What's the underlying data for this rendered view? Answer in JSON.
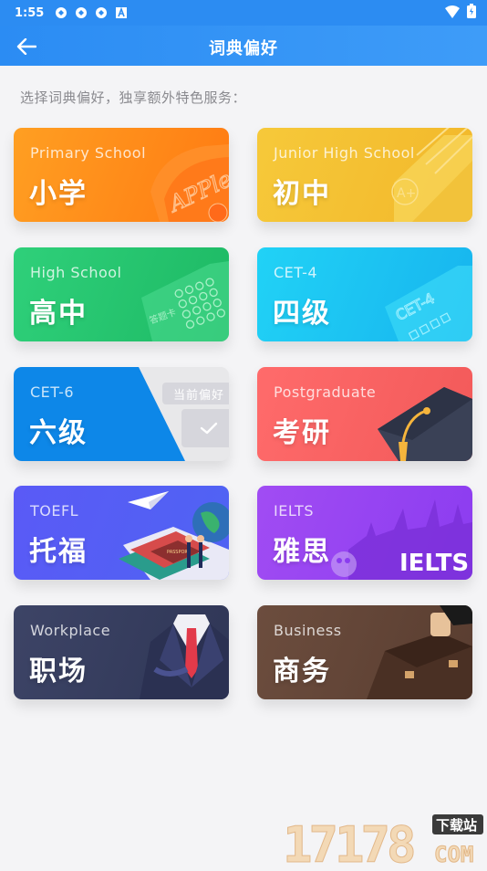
{
  "status_bar": {
    "time": "1:55",
    "icons": [
      "sync-icon",
      "sync-icon",
      "sync-icon",
      "font-icon"
    ],
    "right_icons": [
      "wifi-icon",
      "battery-icon"
    ]
  },
  "app_bar": {
    "title": "词典偏好",
    "back_icon": "arrow-left-icon"
  },
  "hint": "选择词典偏好，独享额外特色服务：",
  "cards": [
    {
      "id": "primary",
      "en": "Primary School",
      "cn": "小学",
      "art": "apple-card"
    },
    {
      "id": "junior",
      "en": "Junior High School",
      "cn": "初中",
      "art": "a-plus-paper"
    },
    {
      "id": "high",
      "en": "High School",
      "cn": "高中",
      "art": "answer-sheet",
      "art_text": "答题卡"
    },
    {
      "id": "cet4",
      "en": "CET-4",
      "cn": "四级",
      "art": "cet-paper",
      "art_text": "CET-4"
    },
    {
      "id": "cet6",
      "en": "CET-6",
      "cn": "六级",
      "selected": true,
      "badge": "当前偏好"
    },
    {
      "id": "post",
      "en": "Postgraduate",
      "cn": "考研",
      "art": "graduation-cap"
    },
    {
      "id": "toefl",
      "en": "TOEFL",
      "cn": "托福",
      "art": "globe-books",
      "art_text": "PASSPORT"
    },
    {
      "id": "ielts",
      "en": "IELTS",
      "cn": "雅思",
      "art": "ielts-city",
      "art_text": "IELTS"
    },
    {
      "id": "work",
      "en": "Workplace",
      "cn": "职场",
      "art": "suit"
    },
    {
      "id": "biz",
      "en": "Business",
      "cn": "商务",
      "art": "briefcase"
    }
  ],
  "colors": {
    "header": "#2c8cf2",
    "primary": "#ff8c1a",
    "junior": "#f4c234",
    "high": "#26c56f",
    "cet4": "#1cc3f2",
    "cet6": "#0d87e8",
    "post": "#f76262",
    "toefl": "#5460f4",
    "ielts": "#9643f1",
    "work": "#363d5e",
    "biz": "#634536"
  },
  "watermark": {
    "number": "17178",
    "tag": "下载站",
    "domain": "COM"
  }
}
